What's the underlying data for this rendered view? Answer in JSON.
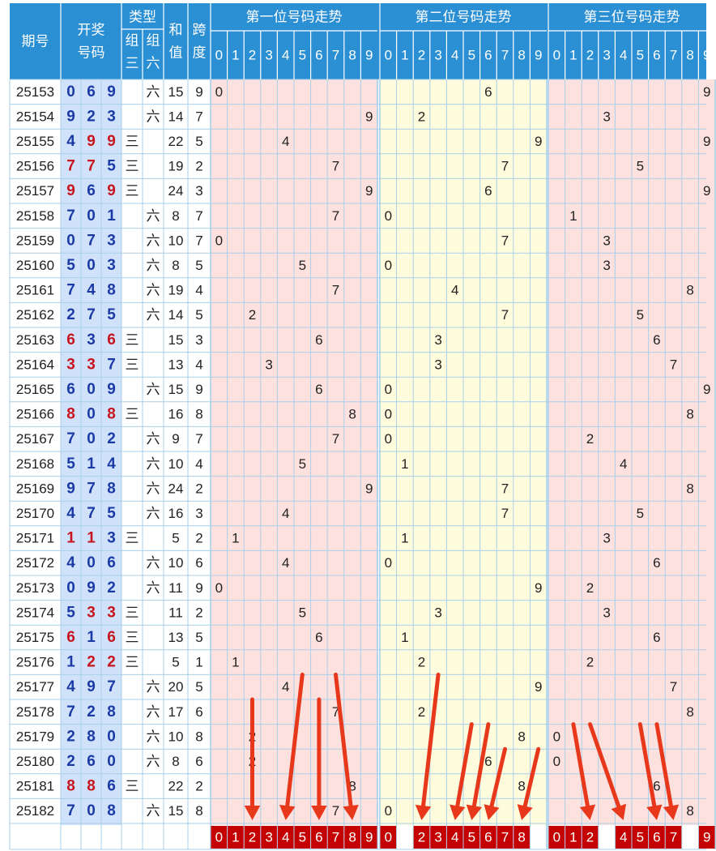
{
  "chart_data": {
    "type": "table",
    "title": "",
    "header": {
      "period": "期号",
      "draw": "开奖号码",
      "type": "类型",
      "type_g3": "组三",
      "type_g6": "组六",
      "sum": "和值",
      "span": "跨度",
      "pos1": "第一位号码走势",
      "pos2": "第二位号码走势",
      "pos3": "第三位号码走势",
      "digits": [
        "0",
        "1",
        "2",
        "3",
        "4",
        "5",
        "6",
        "7",
        "8",
        "9"
      ]
    },
    "type_labels": {
      "g3": "三",
      "g6": "六"
    },
    "rows": [
      {
        "period": "25153",
        "digits": [
          0,
          6,
          9
        ],
        "type": "g6",
        "sum": 15,
        "span": 9
      },
      {
        "period": "25154",
        "digits": [
          9,
          2,
          3
        ],
        "type": "g6",
        "sum": 14,
        "span": 7
      },
      {
        "period": "25155",
        "digits": [
          4,
          9,
          9
        ],
        "type": "g3",
        "sum": 22,
        "span": 5
      },
      {
        "period": "25156",
        "digits": [
          7,
          7,
          5
        ],
        "type": "g3",
        "sum": 19,
        "span": 2
      },
      {
        "period": "25157",
        "digits": [
          9,
          6,
          9
        ],
        "type": "g3",
        "sum": 24,
        "span": 3
      },
      {
        "period": "25158",
        "digits": [
          7,
          0,
          1
        ],
        "type": "g6",
        "sum": 8,
        "span": 7
      },
      {
        "period": "25159",
        "digits": [
          0,
          7,
          3
        ],
        "type": "g6",
        "sum": 10,
        "span": 7
      },
      {
        "period": "25160",
        "digits": [
          5,
          0,
          3
        ],
        "type": "g6",
        "sum": 8,
        "span": 5
      },
      {
        "period": "25161",
        "digits": [
          7,
          4,
          8
        ],
        "type": "g6",
        "sum": 19,
        "span": 4
      },
      {
        "period": "25162",
        "digits": [
          2,
          7,
          5
        ],
        "type": "g6",
        "sum": 14,
        "span": 5
      },
      {
        "period": "25163",
        "digits": [
          6,
          3,
          6
        ],
        "type": "g3",
        "sum": 15,
        "span": 3
      },
      {
        "period": "25164",
        "digits": [
          3,
          3,
          7
        ],
        "type": "g3",
        "sum": 13,
        "span": 4
      },
      {
        "period": "25165",
        "digits": [
          6,
          0,
          9
        ],
        "type": "g6",
        "sum": 15,
        "span": 9
      },
      {
        "period": "25166",
        "digits": [
          8,
          0,
          8
        ],
        "type": "g3",
        "sum": 16,
        "span": 8
      },
      {
        "period": "25167",
        "digits": [
          7,
          0,
          2
        ],
        "type": "g6",
        "sum": 9,
        "span": 7
      },
      {
        "period": "25168",
        "digits": [
          5,
          1,
          4
        ],
        "type": "g6",
        "sum": 10,
        "span": 4
      },
      {
        "period": "25169",
        "digits": [
          9,
          7,
          8
        ],
        "type": "g6",
        "sum": 24,
        "span": 2
      },
      {
        "period": "25170",
        "digits": [
          4,
          7,
          5
        ],
        "type": "g6",
        "sum": 16,
        "span": 3
      },
      {
        "period": "25171",
        "digits": [
          1,
          1,
          3
        ],
        "type": "g3",
        "sum": 5,
        "span": 2
      },
      {
        "period": "25172",
        "digits": [
          4,
          0,
          6
        ],
        "type": "g6",
        "sum": 10,
        "span": 6
      },
      {
        "period": "25173",
        "digits": [
          0,
          9,
          2
        ],
        "type": "g6",
        "sum": 11,
        "span": 9
      },
      {
        "period": "25174",
        "digits": [
          5,
          3,
          3
        ],
        "type": "g3",
        "sum": 11,
        "span": 2
      },
      {
        "period": "25175",
        "digits": [
          6,
          1,
          6
        ],
        "type": "g3",
        "sum": 13,
        "span": 5
      },
      {
        "period": "25176",
        "digits": [
          1,
          2,
          2
        ],
        "type": "g3",
        "sum": 5,
        "span": 1
      },
      {
        "period": "25177",
        "digits": [
          4,
          9,
          7
        ],
        "type": "g6",
        "sum": 20,
        "span": 5
      },
      {
        "period": "25178",
        "digits": [
          7,
          2,
          8
        ],
        "type": "g6",
        "sum": 17,
        "span": 6
      },
      {
        "period": "25179",
        "digits": [
          2,
          8,
          0
        ],
        "type": "g6",
        "sum": 10,
        "span": 8
      },
      {
        "period": "25180",
        "digits": [
          2,
          6,
          0
        ],
        "type": "g6",
        "sum": 8,
        "span": 6
      },
      {
        "period": "25181",
        "digits": [
          8,
          8,
          6
        ],
        "type": "g3",
        "sum": 22,
        "span": 2
      },
      {
        "period": "25182",
        "digits": [
          7,
          0,
          8
        ],
        "type": "g6",
        "sum": 15,
        "span": 8
      }
    ],
    "predictions": {
      "pos1": [
        0,
        1,
        2,
        3,
        4,
        5,
        6,
        7,
        8,
        9
      ],
      "pos2": [
        0,
        2,
        3,
        4,
        5,
        6,
        7,
        8
      ],
      "pos3": [
        0,
        1,
        2,
        4,
        5,
        6,
        7,
        9
      ]
    },
    "arrows": [
      {
        "from": {
          "period": "25178",
          "pos": 1,
          "digit": 2
        },
        "to": {
          "pos": 1,
          "digit": 2
        }
      },
      {
        "from": {
          "period": "25177",
          "pos": 1,
          "digit": 5
        },
        "to": {
          "pos": 1,
          "digit": 4
        }
      },
      {
        "from": {
          "period": "25178",
          "pos": 1,
          "digit": 6
        },
        "to": {
          "pos": 1,
          "digit": 6
        }
      },
      {
        "from": {
          "period": "25177",
          "pos": 1,
          "digit": 7
        },
        "to": {
          "pos": 1,
          "digit": 8
        }
      },
      {
        "from": {
          "period": "25177",
          "pos": 2,
          "digit": 3
        },
        "to": {
          "pos": 2,
          "digit": 2
        }
      },
      {
        "from": {
          "period": "25179",
          "pos": 2,
          "digit": 5
        },
        "to": {
          "pos": 2,
          "digit": 4
        }
      },
      {
        "from": {
          "period": "25179",
          "pos": 2,
          "digit": 6
        },
        "to": {
          "pos": 2,
          "digit": 5
        }
      },
      {
        "from": {
          "period": "25180",
          "pos": 2,
          "digit": 7
        },
        "to": {
          "pos": 2,
          "digit": 6
        }
      },
      {
        "from": {
          "period": "25180",
          "pos": 2,
          "digit": 9
        },
        "to": {
          "pos": 2,
          "digit": 8
        }
      },
      {
        "from": {
          "period": "25179",
          "pos": 3,
          "digit": 1
        },
        "to": {
          "pos": 3,
          "digit": 2
        }
      },
      {
        "from": {
          "period": "25179",
          "pos": 3,
          "digit": 2
        },
        "to": {
          "pos": 3,
          "digit": 4
        }
      },
      {
        "from": {
          "period": "25179",
          "pos": 3,
          "digit": 5
        },
        "to": {
          "pos": 3,
          "digit": 6
        }
      },
      {
        "from": {
          "period": "25179",
          "pos": 3,
          "digit": 6
        },
        "to": {
          "pos": 3,
          "digit": 7
        }
      }
    ],
    "colors": {
      "header_bg": "#2b8fd4",
      "header_text": "#ffffff",
      "period_bg": "#ffffff",
      "draw_bg": "#cfe2fa",
      "draw_text_normal": "#1c3aa6",
      "draw_text_pair": "#c8141e",
      "pos1_bg": "#fde1df",
      "pos2_bg": "#fefcdc",
      "pos3_bg": "#fde1df",
      "grid_line": "#a9cfe9",
      "trend_text": "#222222",
      "prediction_bg": "#c40000",
      "prediction_text": "#ffffff",
      "arrow": "#e8381c"
    }
  }
}
